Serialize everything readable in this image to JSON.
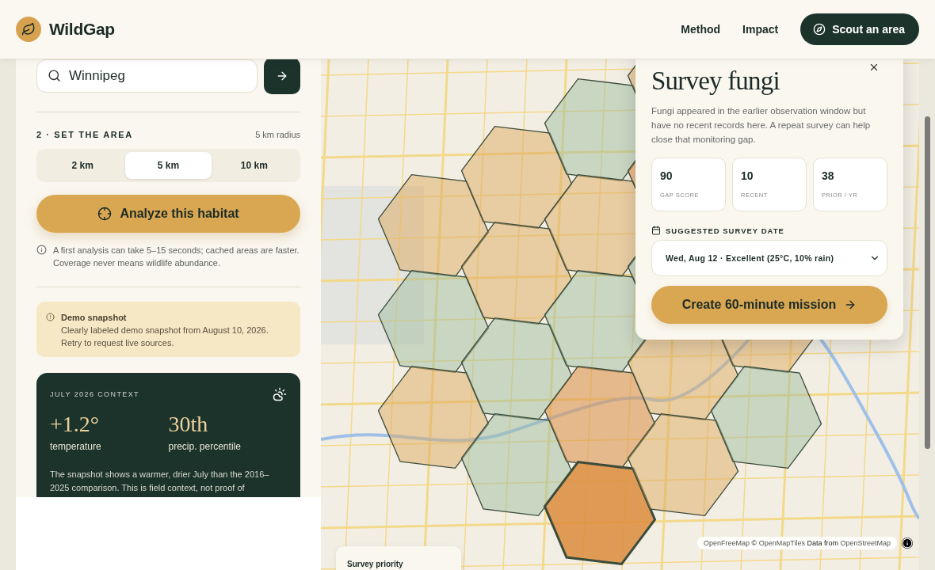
{
  "header": {
    "brand": "WildGap",
    "nav": [
      {
        "label": "Method"
      },
      {
        "label": "Impact"
      }
    ],
    "cta": "Scout an area"
  },
  "sidebar": {
    "search": {
      "value": "Winnipeg"
    },
    "area": {
      "heading": "2 · SET THE AREA",
      "reading": "5 km radius",
      "options": [
        {
          "label": "2 km",
          "selected": false
        },
        {
          "label": "5 km",
          "selected": true
        },
        {
          "label": "10 km",
          "selected": false
        }
      ]
    },
    "analyze_button": "Analyze this habitat",
    "note": "A first analysis can take 5–15 seconds; cached areas are faster. Coverage never means wildlife abundance.",
    "notice": {
      "title": "Demo snapshot",
      "text": "Clearly labeled demo snapshot from August 10, 2026. Retry to request live sources."
    },
    "context": {
      "heading": "JULY 2026 CONTEXT",
      "stats": [
        {
          "value": "+1.2°",
          "label": "temperature"
        },
        {
          "value": "30th",
          "label": "precip. percentile"
        }
      ],
      "text": "The snapshot shows a warmer, drier July than the 2016–2025 comparison. This is field context, not proof of"
    }
  },
  "map": {
    "legend_title": "Survey priority",
    "attribution": [
      {
        "kind": "link",
        "text": "OpenFreeMap"
      },
      {
        "kind": "text",
        "text": "©"
      },
      {
        "kind": "link",
        "text": "OpenMapTiles"
      },
      {
        "kind": "text",
        "text": "Data from"
      },
      {
        "kind": "link",
        "text": "OpenStreetMap"
      }
    ]
  },
  "popup": {
    "title": "Survey fungi",
    "text": "Fungi appeared in the earlier observation window but have no recent records here. A repeat survey can help close that monitoring gap.",
    "metrics": [
      {
        "value": "90",
        "label": "GAP SCORE"
      },
      {
        "value": "10",
        "label": "RECENT"
      },
      {
        "value": "38",
        "label": "PRIOR / YR"
      }
    ],
    "date_label": "SUGGESTED SURVEY DATE",
    "date_value": "Wed, Aug 12 · Excellent (25°C, 10% rain)",
    "button": "Create 60-minute mission"
  }
}
